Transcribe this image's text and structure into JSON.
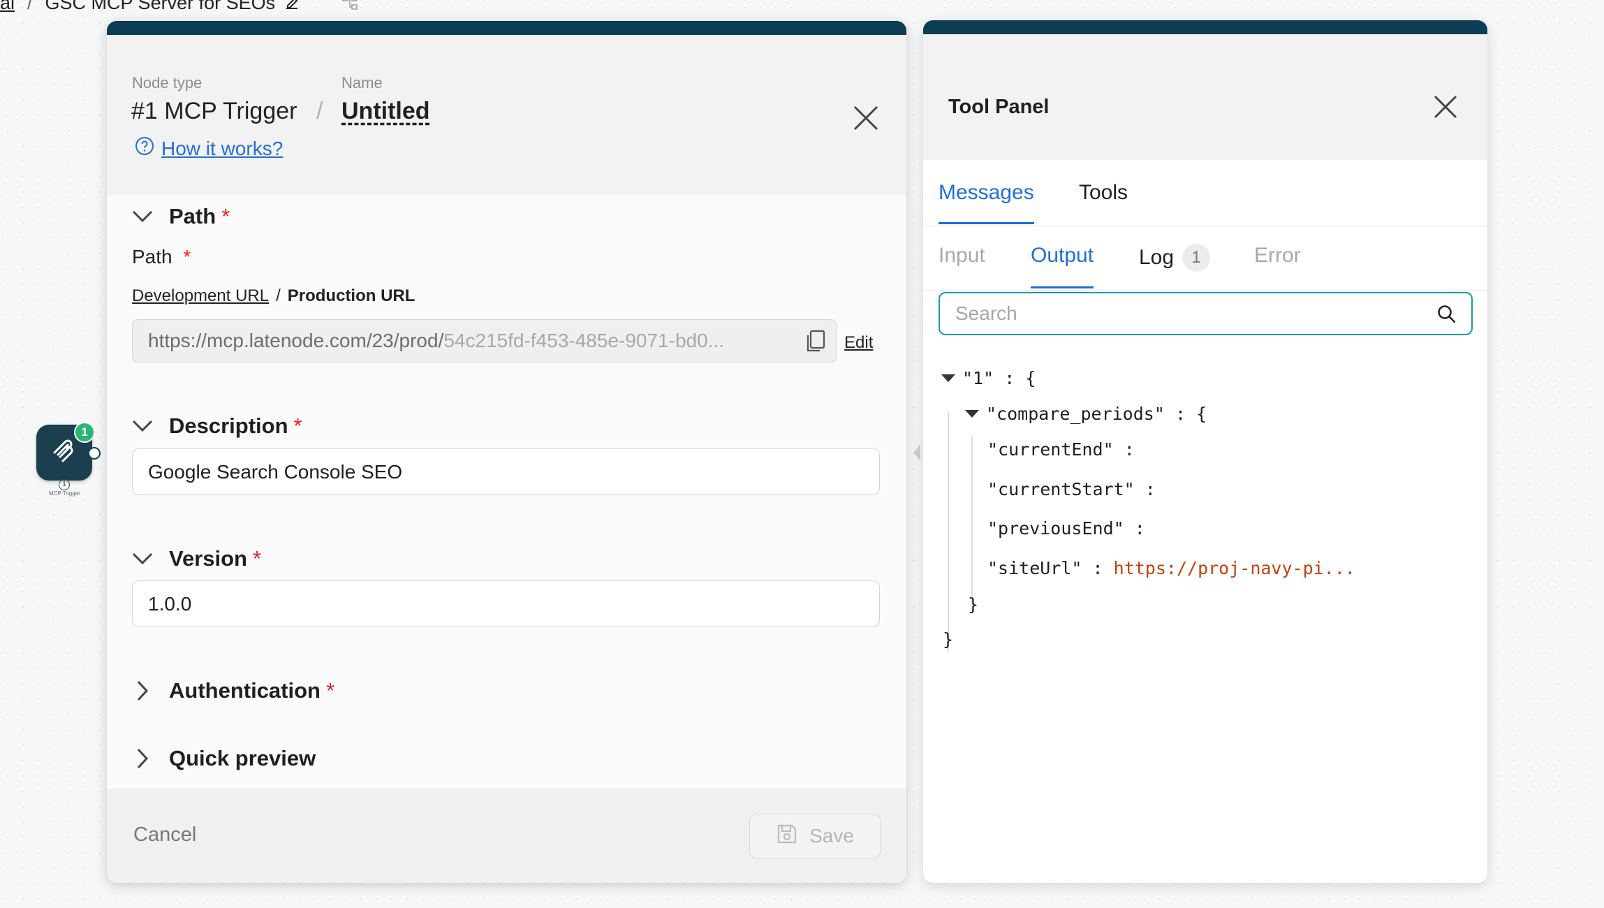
{
  "breadcrumb": {
    "prev": "al",
    "sep": "/",
    "current": "GSC MCP Server for SEOs"
  },
  "canvas_node": {
    "badge": "1",
    "number": "1",
    "label": "MCP Trigger"
  },
  "dialog": {
    "node_type_label": "Node type",
    "name_label": "Name",
    "node_type_value": "#1 MCP Trigger",
    "slash": "/",
    "name_value": "Untitled",
    "how_it_works": "How it works?",
    "sections": {
      "path": "Path",
      "description": "Description",
      "version": "Version",
      "authentication": "Authentication",
      "quick_preview": "Quick preview"
    },
    "required_mark": "*",
    "path_field_label": "Path",
    "dev_url": "Development URL",
    "url_sep": "/",
    "prod_url": "Production URL",
    "url_prefix": "https://mcp.latenode.com/23/prod/",
    "url_suffix": "54c215fd-f453-485e-9071-bd0...",
    "edit": "Edit",
    "description_value": "Google Search Console SEO",
    "version_value": "1.0.0",
    "cancel": "Cancel",
    "save": "Save"
  },
  "tool_panel": {
    "title": "Tool Panel",
    "tabs": [
      "Messages",
      "Tools"
    ],
    "subtabs": [
      "Input",
      "Output",
      "Log",
      "Error"
    ],
    "log_count": "1",
    "search_placeholder": "Search",
    "json": {
      "root_key": "\"1\"",
      "obj_key": "\"compare_periods\"",
      "colon": ":",
      "open_brace": "{",
      "close_brace": "}",
      "keys": [
        "\"currentEnd\"",
        "\"currentStart\"",
        "\"previousEnd\"",
        "\"siteUrl\""
      ],
      "site_url_value": "https://proj-navy-pi..."
    }
  },
  "colors": {
    "accent": "#1f6fd6",
    "header_bar": "#0d3d54",
    "required": "#e02424",
    "json_string": "#c2410c",
    "search_border": "#1a98a8"
  }
}
